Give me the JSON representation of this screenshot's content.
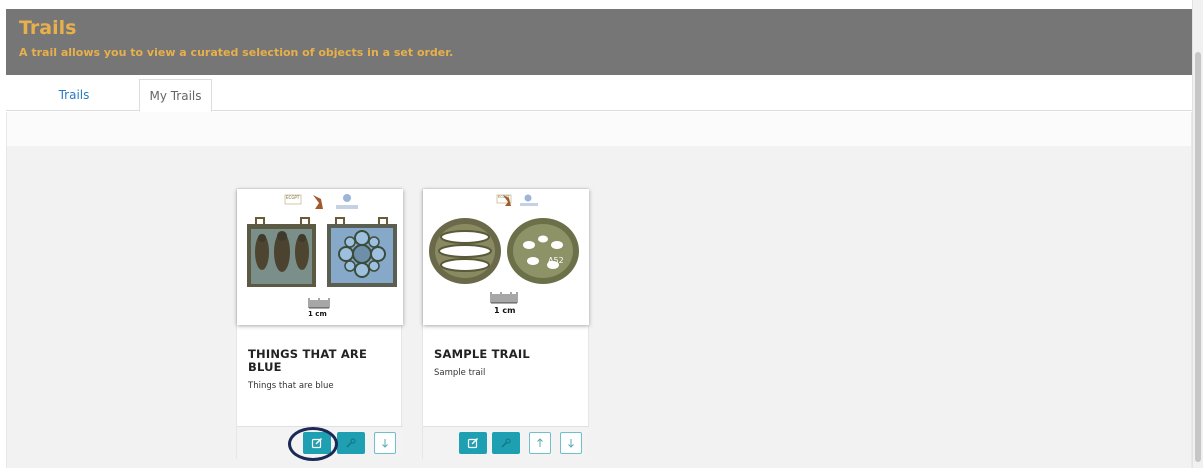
{
  "header": {
    "title": "Trails",
    "subtitle": "A trail allows you to view a curated selection of objects in a set order."
  },
  "tabs": [
    {
      "label": "Trails",
      "active": false
    },
    {
      "label": "My Trails",
      "active": true
    }
  ],
  "cards": [
    {
      "title": "THINGS THAT ARE BLUE",
      "description": "Things that are blue",
      "image_scale_label": "1 cm",
      "image_badge": "ECGPT",
      "buttons": [
        "edit-icon",
        "wrench-icon",
        "arrow-down-icon"
      ],
      "edit_button_highlighted": true
    },
    {
      "title": "SAMPLE TRAIL",
      "description": "Sample trail",
      "image_scale_label": "1 cm",
      "image_badge": "ECGPT",
      "image_object_label": "A52",
      "buttons": [
        "edit-icon",
        "wrench-icon",
        "arrow-up-icon",
        "arrow-down-icon"
      ]
    }
  ],
  "colors": {
    "header_bg": "#767676",
    "header_text": "#e8b04a",
    "tab_link": "#2a7bc2",
    "button_teal": "#1fa0b2",
    "highlight_ring": "#1a2a55"
  }
}
